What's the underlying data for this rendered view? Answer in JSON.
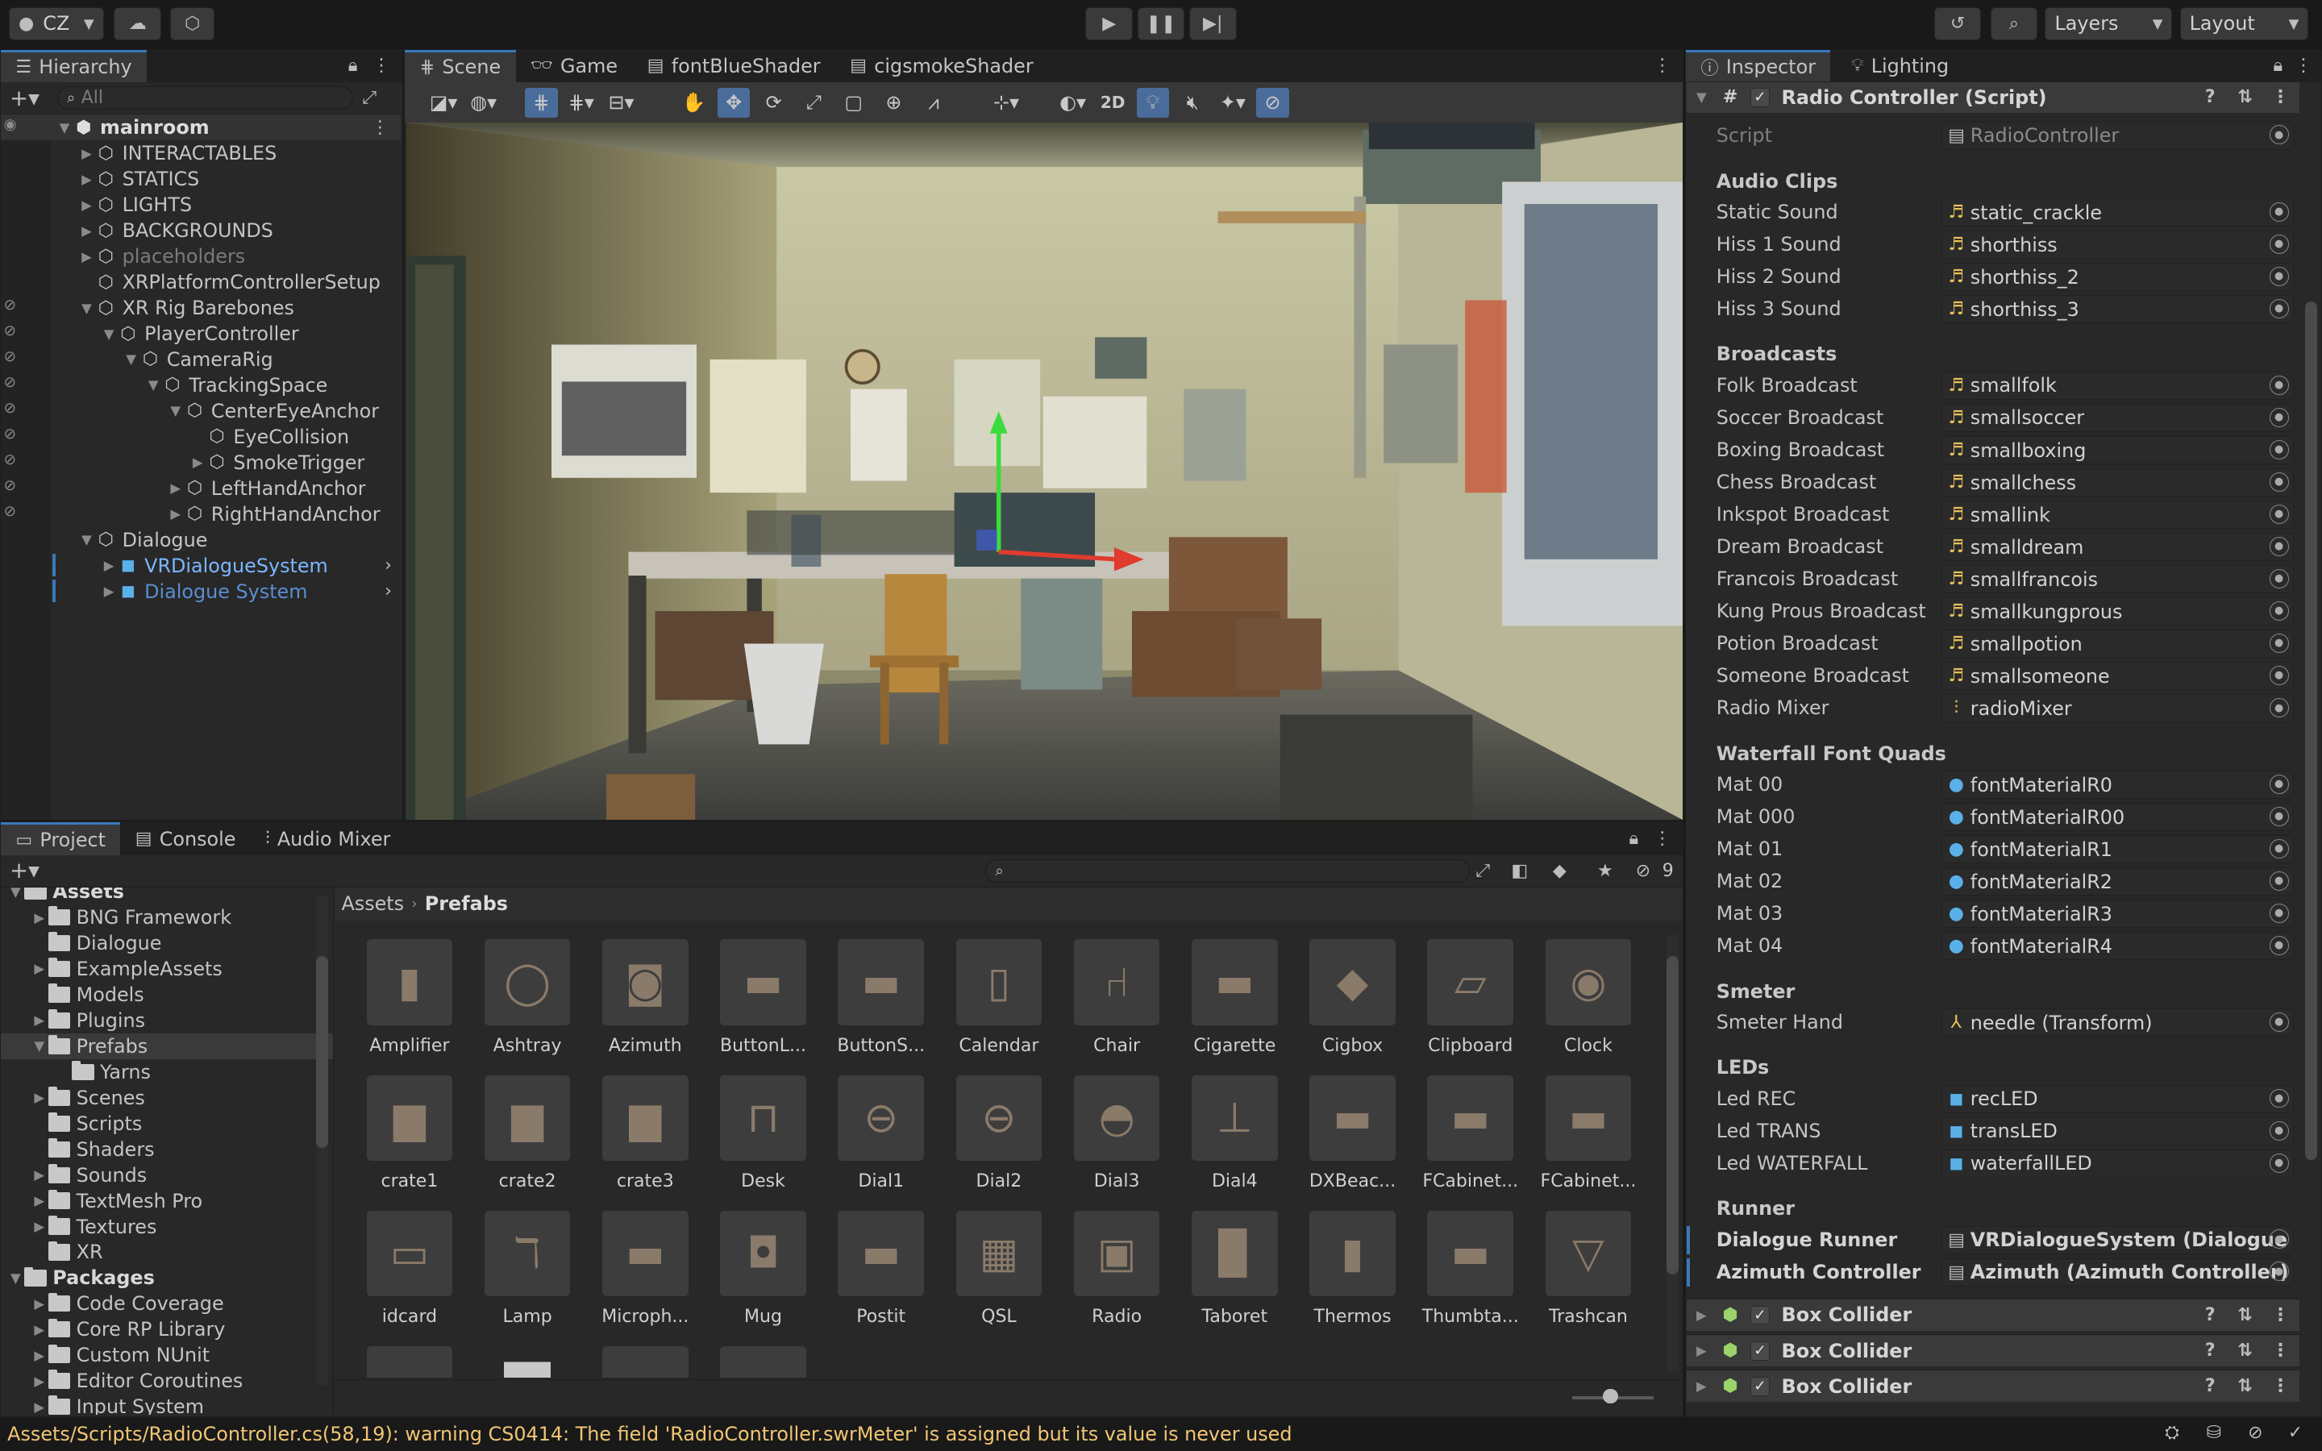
{
  "toolbar": {
    "account": "CZ",
    "layers": "Layers",
    "layout": "Layout"
  },
  "hierarchy": {
    "tab": "Hierarchy",
    "search_placeholder": "All",
    "root": "mainroom",
    "items": [
      {
        "label": "INTERACTABLES",
        "depth": 1
      },
      {
        "label": "STATICS",
        "depth": 1
      },
      {
        "label": "LIGHTS",
        "depth": 1
      },
      {
        "label": "BACKGROUNDS",
        "depth": 1
      },
      {
        "label": "placeholders",
        "depth": 1
      },
      {
        "label": "XRPlatformControllerSetup",
        "depth": 1
      },
      {
        "label": "XR Rig Barebones",
        "depth": 1
      },
      {
        "label": "PlayerController",
        "depth": 2
      },
      {
        "label": "CameraRig",
        "depth": 3
      },
      {
        "label": "TrackingSpace",
        "depth": 4
      },
      {
        "label": "CenterEyeAnchor",
        "depth": 5
      },
      {
        "label": "EyeCollision",
        "depth": 6
      },
      {
        "label": "SmokeTrigger",
        "depth": 6
      },
      {
        "label": "LeftHandAnchor",
        "depth": 5
      },
      {
        "label": "RightHandAnchor",
        "depth": 5
      },
      {
        "label": "Dialogue",
        "depth": 1
      },
      {
        "label": "VRDialogueSystem",
        "depth": 2
      },
      {
        "label": "Dialogue System",
        "depth": 2
      }
    ]
  },
  "scene_tabs": [
    "Scene",
    "Game",
    "fontBlueShader",
    "cigsmokeShader"
  ],
  "scene_toolbar": {
    "mode_2d": "2D"
  },
  "project_tabs": [
    "Project",
    "Console",
    "Audio Mixer"
  ],
  "project_search_count": "9",
  "project_tree": [
    {
      "label": "Assets",
      "depth": 0,
      "bold": true
    },
    {
      "label": "BNG Framework",
      "depth": 1
    },
    {
      "label": "Dialogue",
      "depth": 1
    },
    {
      "label": "ExampleAssets",
      "depth": 1
    },
    {
      "label": "Models",
      "depth": 1
    },
    {
      "label": "Plugins",
      "depth": 1
    },
    {
      "label": "Prefabs",
      "depth": 1
    },
    {
      "label": "Yarns",
      "depth": 2
    },
    {
      "label": "Scenes",
      "depth": 1
    },
    {
      "label": "Scripts",
      "depth": 1
    },
    {
      "label": "Shaders",
      "depth": 1
    },
    {
      "label": "Sounds",
      "depth": 1
    },
    {
      "label": "TextMesh Pro",
      "depth": 1
    },
    {
      "label": "Textures",
      "depth": 1
    },
    {
      "label": "XR",
      "depth": 1
    },
    {
      "label": "Packages",
      "depth": 0,
      "bold": true
    },
    {
      "label": "Code Coverage",
      "depth": 1
    },
    {
      "label": "Core RP Library",
      "depth": 1
    },
    {
      "label": "Custom NUnit",
      "depth": 1
    },
    {
      "label": "Editor Coroutines",
      "depth": 1
    },
    {
      "label": "Input System",
      "depth": 1
    }
  ],
  "breadcrumb": {
    "root": "Assets",
    "current": "Prefabs"
  },
  "assets": [
    "Amplifier",
    "Ashtray",
    "Azimuth",
    "ButtonL...",
    "ButtonS...",
    "Calendar",
    "Chair",
    "Cigarette",
    "Cigbox",
    "Clipboard",
    "Clock",
    "crate1",
    "crate2",
    "crate3",
    "Desk",
    "Dial1",
    "Dial2",
    "Dial3",
    "Dial4",
    "DXBeac...",
    "FCabinet...",
    "FCabinet...",
    "idcard",
    "Lamp",
    "Microph...",
    "Mug",
    "Postit",
    "QSL",
    "Radio",
    "Taboret",
    "Thermos",
    "Thumbta...",
    "Trashcan"
  ],
  "inspector": {
    "tabs": [
      "Inspector",
      "Lighting"
    ],
    "component": "Radio Controller (Script)",
    "script_label": "Script",
    "script_value": "RadioController",
    "sections": [
      {
        "header": "Audio Clips",
        "fields": [
          [
            "Static Sound",
            "static_crackle",
            "audio"
          ],
          [
            "Hiss 1 Sound",
            "shorthiss",
            "audio"
          ],
          [
            "Hiss 2 Sound",
            "shorthiss_2",
            "audio"
          ],
          [
            "Hiss 3 Sound",
            "shorthiss_3",
            "audio"
          ]
        ]
      },
      {
        "header": "Broadcasts",
        "fields": [
          [
            "Folk Broadcast",
            "smallfolk",
            "audio"
          ],
          [
            "Soccer Broadcast",
            "smallsoccer",
            "audio"
          ],
          [
            "Boxing Broadcast",
            "smallboxing",
            "audio"
          ],
          [
            "Chess Broadcast",
            "smallchess",
            "audio"
          ],
          [
            "Inkspot Broadcast",
            "smallink",
            "audio"
          ],
          [
            "Dream Broadcast",
            "smalldream",
            "audio"
          ],
          [
            "Francois Broadcast",
            "smallfrancois",
            "audio"
          ],
          [
            "Kung Prous Broadcast",
            "smallkungprous",
            "audio"
          ],
          [
            "Potion Broadcast",
            "smallpotion",
            "audio"
          ],
          [
            "Someone Broadcast",
            "smallsomeone",
            "audio"
          ],
          [
            "Radio Mixer",
            "radioMixer",
            "mixer"
          ]
        ]
      },
      {
        "header": "Waterfall Font Quads",
        "fields": [
          [
            "Mat 00",
            "fontMaterialR0",
            "material"
          ],
          [
            "Mat 000",
            "fontMaterialR00",
            "material"
          ],
          [
            "Mat 01",
            "fontMaterialR1",
            "material"
          ],
          [
            "Mat 02",
            "fontMaterialR2",
            "material"
          ],
          [
            "Mat 03",
            "fontMaterialR3",
            "material"
          ],
          [
            "Mat 04",
            "fontMaterialR4",
            "material"
          ]
        ]
      },
      {
        "header": "Smeter",
        "fields": [
          [
            "Smeter Hand",
            "needle (Transform)",
            "transform"
          ]
        ]
      },
      {
        "header": "LEDs",
        "fields": [
          [
            "Led REC",
            "recLED",
            "prefab"
          ],
          [
            "Led TRANS",
            "transLED",
            "prefab"
          ],
          [
            "Led WATERFALL",
            "waterfallLED",
            "prefab"
          ]
        ]
      },
      {
        "header": "Runner",
        "fields": [
          [
            "Dialogue Runner",
            "VRDialogueSystem (Dialogue R",
            "script"
          ],
          [
            "Azimuth Controller",
            "Azimuth (Azimuth Controller)",
            "script"
          ]
        ]
      }
    ],
    "colliders": [
      "Box Collider",
      "Box Collider",
      "Box Collider"
    ]
  },
  "status": "Assets/Scripts/RadioController.cs(58,19): warning CS0414: The field 'RadioController.swrMeter' is assigned but its value is never used",
  "colors": {
    "accent": "#3a79bb",
    "warning": "#f0c674",
    "selection": "#2c5d87",
    "prefab": "#7cb7ff"
  }
}
